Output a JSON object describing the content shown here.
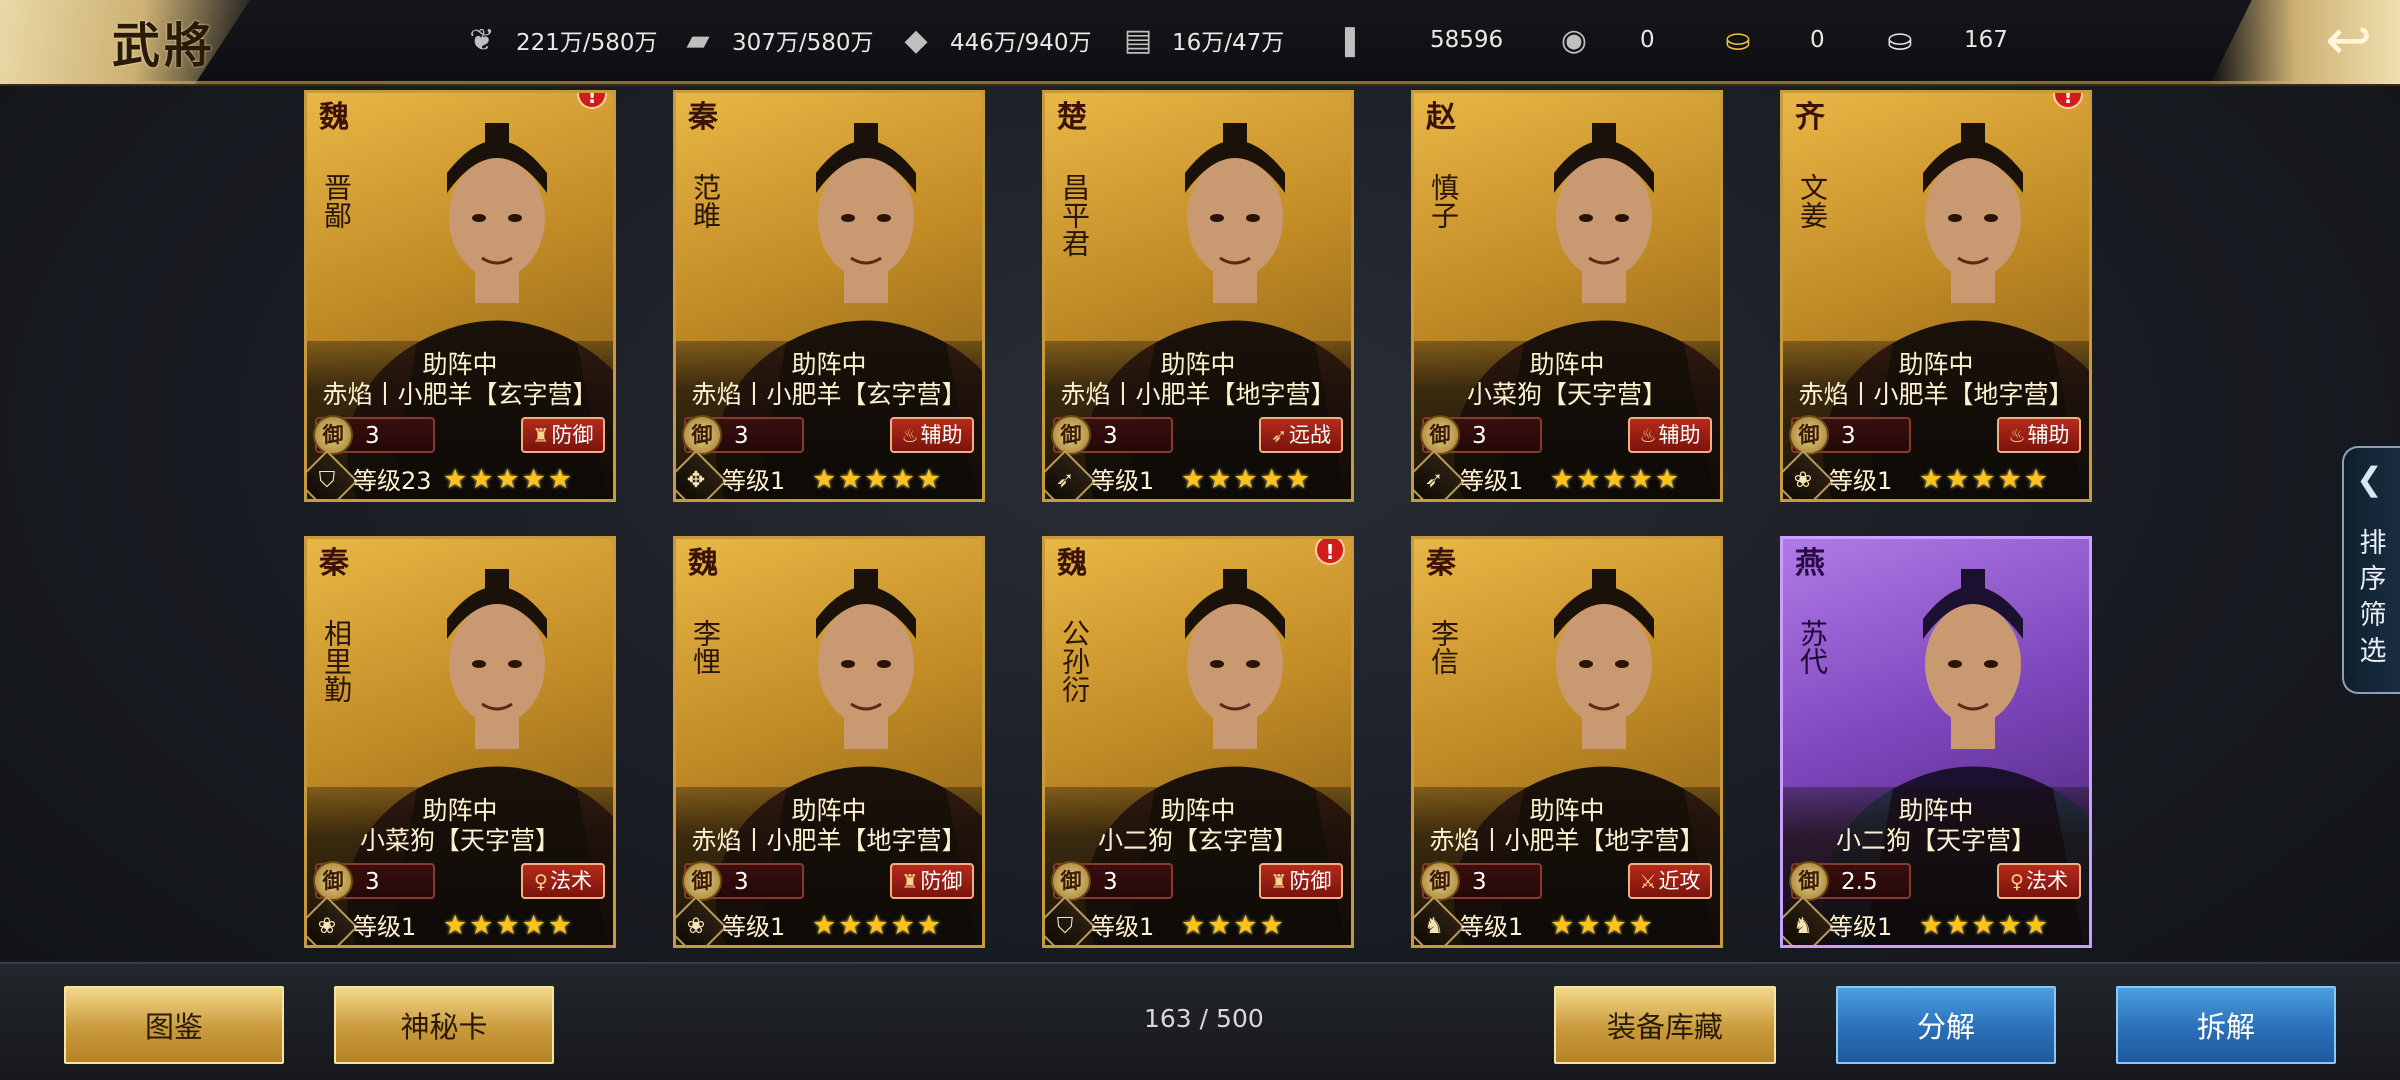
{
  "header": {
    "title": "武將",
    "resources": [
      {
        "icon": "wheat-icon",
        "glyph": "❦",
        "value": "221万/580万"
      },
      {
        "icon": "wood-icon",
        "glyph": "▰",
        "value": "307万/580万"
      },
      {
        "icon": "stone-icon",
        "glyph": "◆",
        "value": "446万/940万"
      },
      {
        "icon": "iron-icon",
        "glyph": "▤",
        "value": "16万/47万"
      },
      {
        "icon": "decree-icon",
        "glyph": "❚",
        "value": "58596"
      },
      {
        "icon": "coin-icon",
        "glyph": "◉",
        "value": "0"
      },
      {
        "icon": "gold-ingot-icon",
        "glyph": "⛀",
        "value": "0"
      },
      {
        "icon": "silver-ingot-icon",
        "glyph": "⛀",
        "value": "167"
      }
    ]
  },
  "cards": [
    {
      "kingdom": "魏",
      "name": "晋鄙",
      "status": "助阵中",
      "team": "赤焰丨小肥羊【玄字营】",
      "cost_label": "御",
      "cost": "3",
      "role": "防御",
      "role_glyph": "♜",
      "level": "等级23",
      "stars": "★★★★★",
      "type_icon": "shield-type-icon",
      "type_glyph": "⛉",
      "alert": "!",
      "purple": false
    },
    {
      "kingdom": "秦",
      "name": "范雎",
      "status": "助阵中",
      "team": "赤焰丨小肥羊【玄字营】",
      "cost_label": "御",
      "cost": "3",
      "role": "辅助",
      "role_glyph": "♨",
      "level": "等级1",
      "stars": "★★★★★",
      "type_icon": "compass-type-icon",
      "type_glyph": "✥",
      "alert": "",
      "purple": false
    },
    {
      "kingdom": "楚",
      "name": "昌平君",
      "status": "助阵中",
      "team": "赤焰丨小肥羊【地字营】",
      "cost_label": "御",
      "cost": "3",
      "role": "远战",
      "role_glyph": "➶",
      "level": "等级1",
      "stars": "★★★★★",
      "type_icon": "bow-type-icon",
      "type_glyph": "➶",
      "alert": "",
      "purple": false
    },
    {
      "kingdom": "赵",
      "name": "慎子",
      "status": "助阵中",
      "team": "小菜狗【天字营】",
      "cost_label": "御",
      "cost": "3",
      "role": "辅助",
      "role_glyph": "♨",
      "level": "等级1",
      "stars": "★★★★★",
      "type_icon": "bow-type-icon",
      "type_glyph": "➶",
      "alert": "",
      "purple": false
    },
    {
      "kingdom": "齐",
      "name": "文姜",
      "status": "助阵中",
      "team": "赤焰丨小肥羊【地字营】",
      "cost_label": "御",
      "cost": "3",
      "role": "辅助",
      "role_glyph": "♨",
      "level": "等级1",
      "stars": "★★★★★",
      "type_icon": "lotus-type-icon",
      "type_glyph": "❀",
      "alert": "!",
      "purple": false
    },
    {
      "kingdom": "秦",
      "name": "相里勤",
      "status": "助阵中",
      "team": "小菜狗【天字营】",
      "cost_label": "御",
      "cost": "3",
      "role": "法术",
      "role_glyph": "♀",
      "level": "等级1",
      "stars": "★★★★★",
      "type_icon": "lotus-type-icon",
      "type_glyph": "❀",
      "alert": "",
      "purple": false
    },
    {
      "kingdom": "魏",
      "name": "李悝",
      "status": "助阵中",
      "team": "赤焰丨小肥羊【地字营】",
      "cost_label": "御",
      "cost": "3",
      "role": "防御",
      "role_glyph": "♜",
      "level": "等级1",
      "stars": "★★★★★",
      "type_icon": "lotus-type-icon",
      "type_glyph": "❀",
      "alert": "",
      "purple": false
    },
    {
      "kingdom": "魏",
      "name": "公孙衍",
      "status": "助阵中",
      "team": "小二狗【玄字营】",
      "cost_label": "御",
      "cost": "3",
      "role": "防御",
      "role_glyph": "♜",
      "level": "等级1",
      "stars": "★★★★",
      "type_icon": "shield-type-icon",
      "type_glyph": "⛉",
      "alert": "!",
      "purple": false
    },
    {
      "kingdom": "秦",
      "name": "李信",
      "status": "助阵中",
      "team": "赤焰丨小肥羊【地字营】",
      "cost_label": "御",
      "cost": "3",
      "role": "近攻",
      "role_glyph": "⚔",
      "level": "等级1",
      "stars": "★★★★",
      "type_icon": "horse-type-icon",
      "type_glyph": "♞",
      "alert": "",
      "purple": false
    },
    {
      "kingdom": "燕",
      "name": "苏代",
      "status": "助阵中",
      "team": "小二狗【天字营】",
      "cost_label": "御",
      "cost": "2.5",
      "role": "法术",
      "role_glyph": "♀",
      "level": "等级1",
      "stars": "★★★★★",
      "type_icon": "horse-type-icon",
      "type_glyph": "♞",
      "alert": "",
      "purple": true
    }
  ],
  "filter": {
    "label": "排序筛选",
    "chevron": "❮"
  },
  "footer": {
    "encyclopedia": "图鉴",
    "mystery_card": "神秘卡",
    "count": "163 / 500",
    "equipment": "装备库藏",
    "decompose": "分解",
    "disassemble": "拆解"
  }
}
